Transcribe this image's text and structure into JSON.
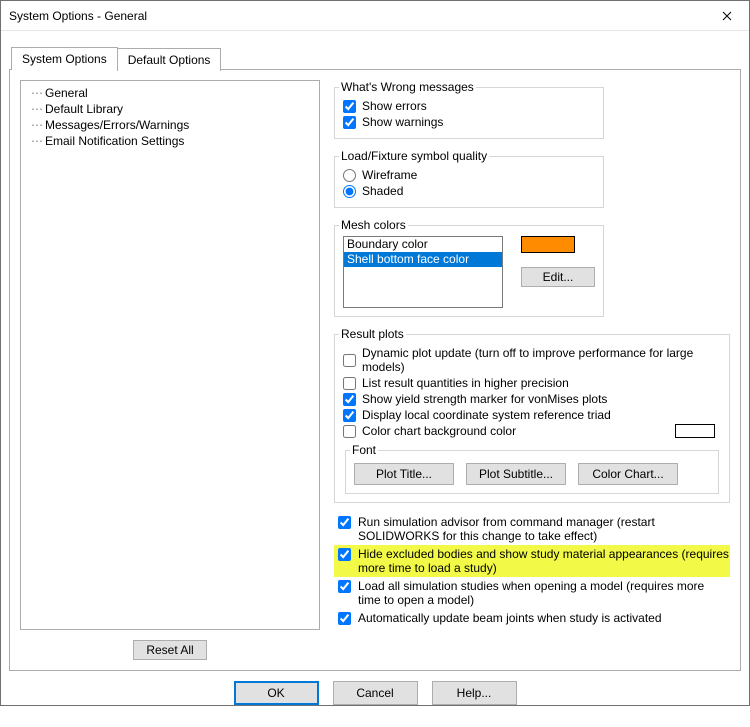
{
  "window": {
    "title": "System Options - General"
  },
  "tabs": {
    "system_options": "System Options",
    "default_options": "Default Options"
  },
  "tree": {
    "items": [
      "General",
      "Default Library",
      "Messages/Errors/Warnings",
      "Email Notification Settings"
    ]
  },
  "groups": {
    "whats_wrong": {
      "legend": "What's Wrong messages",
      "show_errors": "Show errors",
      "show_warnings": "Show warnings"
    },
    "load_fixture": {
      "legend": "Load/Fixture symbol quality",
      "wireframe": "Wireframe",
      "shaded": "Shaded"
    },
    "mesh": {
      "legend": "Mesh colors",
      "items": [
        "Boundary color",
        "Shell bottom face color"
      ],
      "edit": "Edit...",
      "swatch_color": "#ff8c00"
    },
    "result": {
      "legend": "Result plots",
      "dynamic": "Dynamic plot update (turn off to improve performance for large models)",
      "precision": "List result quantities in higher precision",
      "yield": "Show yield strength marker for vonMises plots",
      "triad": "Display local coordinate system reference triad",
      "bgcolor": "Color chart background color",
      "font_legend": "Font",
      "plot_title": "Plot Title...",
      "plot_subtitle": "Plot Subtitle...",
      "color_chart": "Color Chart..."
    }
  },
  "lower": {
    "run_advisor": "Run simulation advisor from command manager (restart SOLIDWORKS for this change to take effect)",
    "hide_excluded": "Hide excluded bodies and show study material appearances (requires more time to load a study)",
    "load_all": "Load all simulation studies when opening a model (requires more time to open a model)",
    "auto_update": "Automatically update beam joints when study is activated"
  },
  "buttons": {
    "reset_all": "Reset All",
    "ok": "OK",
    "cancel": "Cancel",
    "help": "Help..."
  }
}
